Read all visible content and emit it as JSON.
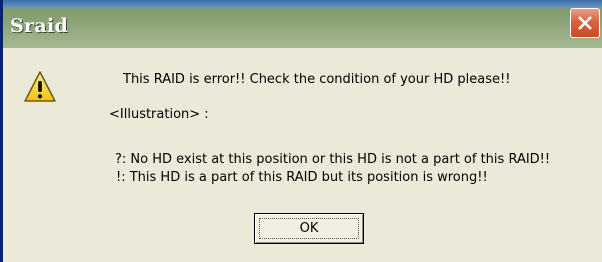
{
  "window": {
    "title": "Sraid",
    "close_icon": "close-icon"
  },
  "dialog": {
    "icon": "warning-icon",
    "message": "This RAID is error!!  Check the condition of your HD please!!",
    "illustration_label": "<Illustration> :",
    "legend_lines": [
      "?: No HD exist at this position or this HD is not a part of this RAID!!",
      "!: This HD is a part of this RAID but its position is wrong!!"
    ],
    "ok_label": "OK"
  },
  "colors": {
    "titlebar": "#8fa77b",
    "close_button": "#d9623f",
    "dialog_background": "#ece9d8",
    "warning_yellow": "#f8d92a"
  }
}
